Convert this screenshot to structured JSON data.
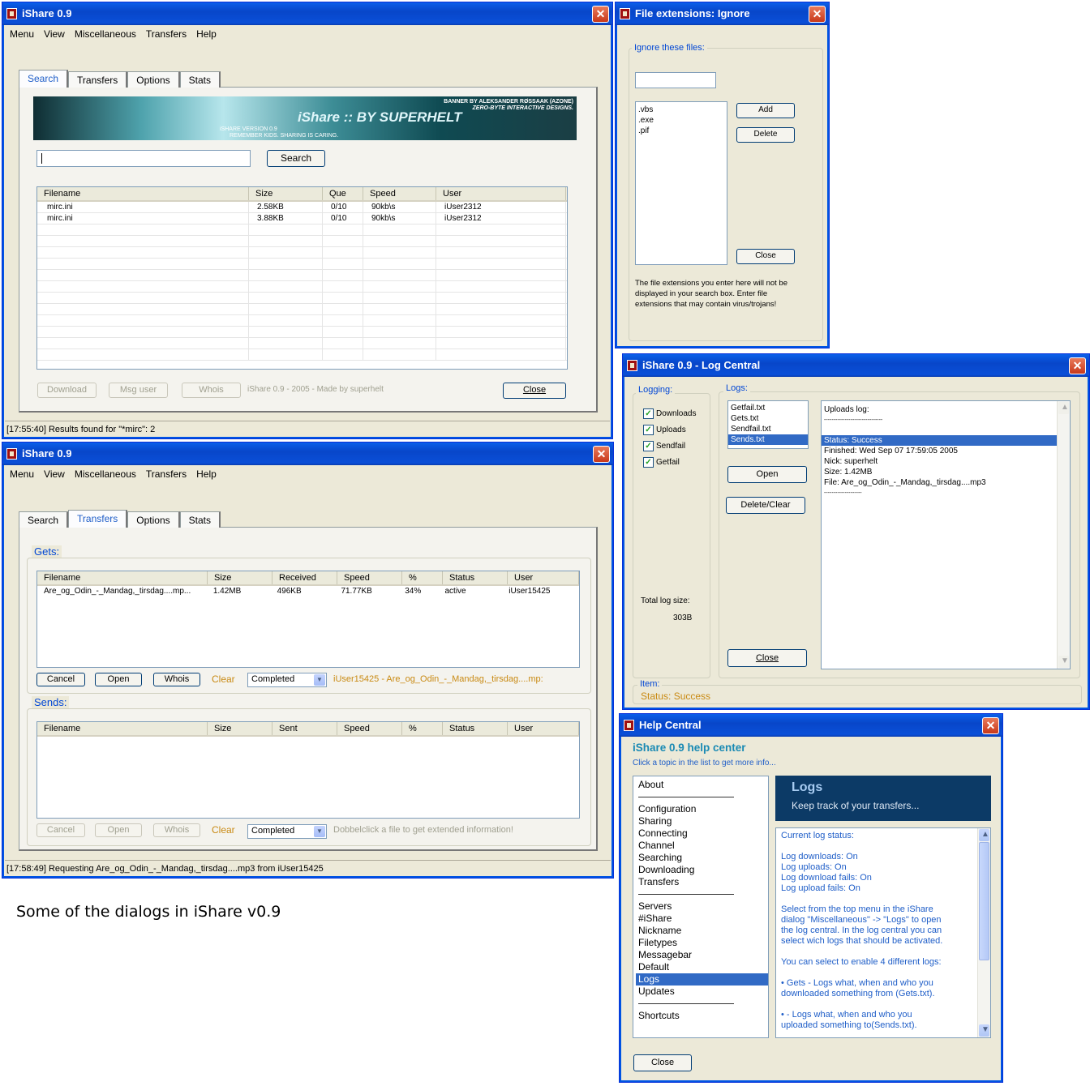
{
  "search_window": {
    "title": "iShare 0.9",
    "menu": [
      "Menu",
      "View",
      "Miscellaneous",
      "Transfers",
      "Help"
    ],
    "tabs": [
      "Search",
      "Transfers",
      "Options",
      "Stats"
    ],
    "banner": {
      "credit1": "BANNER BY ALEKSANDER RØSSAAK (AZONE)",
      "credit2": "ZERO-BYTE INTERACTIVE DESIGNS.",
      "logo": "iShare :: BY SUPERHELT",
      "version": "iSHARE VERSION 0.9",
      "tagline": "REMEMBER KIDS. SHARING IS CARING."
    },
    "search_value": "",
    "search_button": "Search",
    "columns": [
      "Filename",
      "Size",
      "Que",
      "Speed",
      "User"
    ],
    "rows": [
      [
        "mirc.ini",
        "2.58KB",
        "0/10",
        "90kb\\s",
        "iUser2312"
      ],
      [
        "mirc.ini",
        "3.88KB",
        "0/10",
        "90kb\\s",
        "iUser2312"
      ]
    ],
    "download_button": "Download",
    "msg_button": "Msg user",
    "whois_button": "Whois",
    "credit": "iShare 0.9 - 2005 - Made by superhelt",
    "close_button": "Close",
    "status": "[17:55:40] Results found for \"*mirc\": 2"
  },
  "transfers_window": {
    "title": "iShare 0.9",
    "menu": [
      "Menu",
      "View",
      "Miscellaneous",
      "Transfers",
      "Help"
    ],
    "tabs": [
      "Search",
      "Transfers",
      "Options",
      "Stats"
    ],
    "gets_label": "Gets:",
    "gets_columns": [
      "Filename",
      "Size",
      "Received",
      "Speed",
      "%",
      "Status",
      "User"
    ],
    "gets_rows": [
      [
        "Are_og_Odin_-_Mandag,_tirsdag....mp...",
        "1.42MB",
        "496KB",
        "71.77KB",
        "34%",
        "active",
        "iUser15425"
      ]
    ],
    "cancel_button": "Cancel",
    "open_button": "Open",
    "whois_button": "Whois",
    "clear_label": "Clear",
    "filter_value": "Completed",
    "gets_info": "iUser15425 - Are_og_Odin_-_Mandag,_tirsdag....mp:",
    "sends_label": "Sends:",
    "sends_columns": [
      "Filename",
      "Size",
      "Sent",
      "Speed",
      "%",
      "Status",
      "User"
    ],
    "sends_cancel": "Cancel",
    "sends_open": "Open",
    "sends_whois": "Whois",
    "sends_clear": "Clear",
    "sends_filter": "Completed",
    "sends_info": "Dobbelclick a file to get extended information!",
    "status": "[17:58:49] Requesting  Are_og_Odin_-_Mandag,_tirsdag....mp3 from iUser15425"
  },
  "caption": "Some of the dialogs in iShare v0.9",
  "ignore_window": {
    "title": "File extensions: Ignore",
    "group_label": "Ignore these files:",
    "input_value": "",
    "items": [
      ".vbs",
      ".exe",
      ".pif"
    ],
    "add_button": "Add",
    "delete_button": "Delete",
    "close_button": "Close",
    "note": [
      "The file extensions you enter here will not be",
      "displayed in your search box. Enter file",
      "extensions that may contain virus/trojans!"
    ]
  },
  "log_window": {
    "title": "iShare 0.9 - Log Central",
    "logging_label": "Logging:",
    "checks": [
      {
        "label": "Downloads",
        "checked": true
      },
      {
        "label": "Uploads",
        "checked": true
      },
      {
        "label": "Sendfail",
        "checked": true
      },
      {
        "label": "Getfail",
        "checked": true
      }
    ],
    "total_label": "Total log size:",
    "total_value": "303B",
    "logs_label": "Logs:",
    "log_files": [
      "Getfail.txt",
      "Gets.txt",
      "Sendfail.txt",
      "Sends.txt"
    ],
    "selected_file": 3,
    "open_button": "Open",
    "delete_button": "Delete/Clear",
    "close_button": "Close",
    "log_lines": [
      "Uploads log:",
      "-------------------------------",
      "",
      "Status: Success",
      "Finished: Wed Sep 07 17:59:05 2005",
      "Nick: superhelt",
      "Size: 1.42MB",
      "File: Are_og_Odin_-_Mandag,_tirsdag....mp3",
      "--------------------"
    ],
    "selected_line": 3,
    "item_label": "Item:",
    "item_value": "Status: Success"
  },
  "help_window": {
    "title": "Help Central",
    "heading": "iShare 0.9 help center",
    "subheading": "Click a topic in the list to get more info...",
    "topics_a": [
      "About"
    ],
    "topics_b": [
      "Configuration",
      "Sharing",
      "Connecting",
      "Channel",
      "Searching",
      "Downloading",
      "Transfers"
    ],
    "topics_c": [
      "Servers",
      "#iShare",
      "Nickname",
      "Filetypes",
      "Messagebar",
      "Default",
      "Logs",
      "Updates"
    ],
    "topics_d": [
      "Shortcuts"
    ],
    "selected_topic": "Logs",
    "panel_title": "Logs",
    "panel_sub": "Keep track of your transfers...",
    "content": [
      "Current log status:",
      "",
      " Log downloads: On",
      " Log uploads: On",
      " Log download fails: On",
      " Log upload fails: On",
      "",
      " Select from the top menu in the iShare",
      "dialog \"Miscellaneous\" -> \"Logs\" to open",
      "the log central. In the log central you can",
      "select wich logs that should be activated.",
      "",
      " You can select to enable 4 different logs:",
      "",
      " • Gets - Logs what, when and who you",
      "downloaded something from (Gets.txt).",
      "",
      " • - Logs what, when and who you",
      "uploaded something to(Sends.txt)."
    ],
    "close_button": "Close"
  }
}
